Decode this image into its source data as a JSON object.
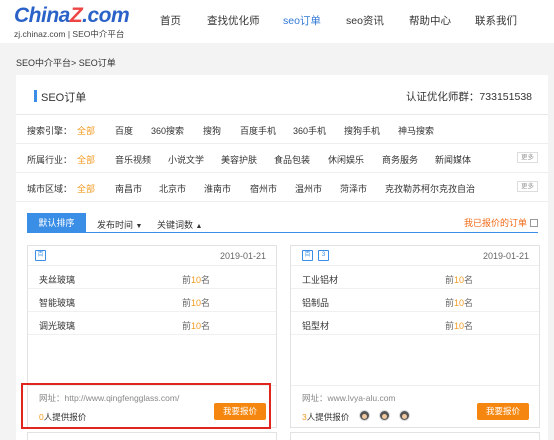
{
  "header": {
    "logo_main_a": "China",
    "logo_main_z": "Z",
    "logo_main_b": ".com",
    "logo_sub": "zj.chinaz.com | SEO中介平台",
    "nav": [
      "首页",
      "查找优化师",
      "seo订单",
      "seo资讯",
      "帮助中心",
      "联系我们"
    ],
    "active_nav": "seo订单"
  },
  "breadcrumb": "SEO中介平台> SEO订单",
  "panel": {
    "title": "SEO订单",
    "qq_group": "认证优化师群：733151538"
  },
  "filters": {
    "engine": {
      "label": "搜索引擎：",
      "items": [
        "全部",
        "百度",
        "360搜索",
        "搜狗",
        "百度手机",
        "360手机",
        "搜狗手机",
        "神马搜索"
      ]
    },
    "industry": {
      "label": "所属行业：",
      "items": [
        "全部",
        "音乐视频",
        "小说文学",
        "美容护肤",
        "食品包装",
        "休闲娱乐",
        "商务服务",
        "新闻媒体"
      ],
      "more": "更多"
    },
    "region": {
      "label": "城市区域：",
      "items": [
        "全部",
        "南昌市",
        "北京市",
        "淮南市",
        "宿州市",
        "温州市",
        "菏泽市",
        "克孜勒苏柯尔克孜自治"
      ],
      "more": "更多"
    }
  },
  "sort": {
    "default": "默认排序",
    "time": "发布时间",
    "keywords": "关键词数",
    "my_orders": "我已报价的订单"
  },
  "cards": [
    {
      "date": "2019-01-21",
      "keywords": [
        {
          "name": "夹丝玻璃",
          "prefix": "前",
          "rank": "10",
          "suffix": "名"
        },
        {
          "name": "智能玻璃",
          "prefix": "前",
          "rank": "10",
          "suffix": "名"
        },
        {
          "name": "调光玻璃",
          "prefix": "前",
          "rank": "10",
          "suffix": "名"
        }
      ],
      "site": "网址：http://www.qingfengglass.com/",
      "quote_count": "0",
      "quote_text": "人提供报价",
      "bid_label": "我要报价"
    },
    {
      "date": "2019-01-21",
      "keywords": [
        {
          "name": "工业铝材",
          "prefix": "前",
          "rank": "10",
          "suffix": "名"
        },
        {
          "name": "铝制品",
          "prefix": "前",
          "rank": "10",
          "suffix": "名"
        },
        {
          "name": "铝型材",
          "prefix": "前",
          "rank": "10",
          "suffix": "名"
        }
      ],
      "site": "网址：www.lvya-alu.com",
      "quote_count": "3",
      "quote_text": "人提供报价",
      "bid_label": "我要报价"
    }
  ],
  "colors": {
    "accent": "#3a8ee6",
    "orange": "#f5860f",
    "highlight": "#e0251f"
  }
}
